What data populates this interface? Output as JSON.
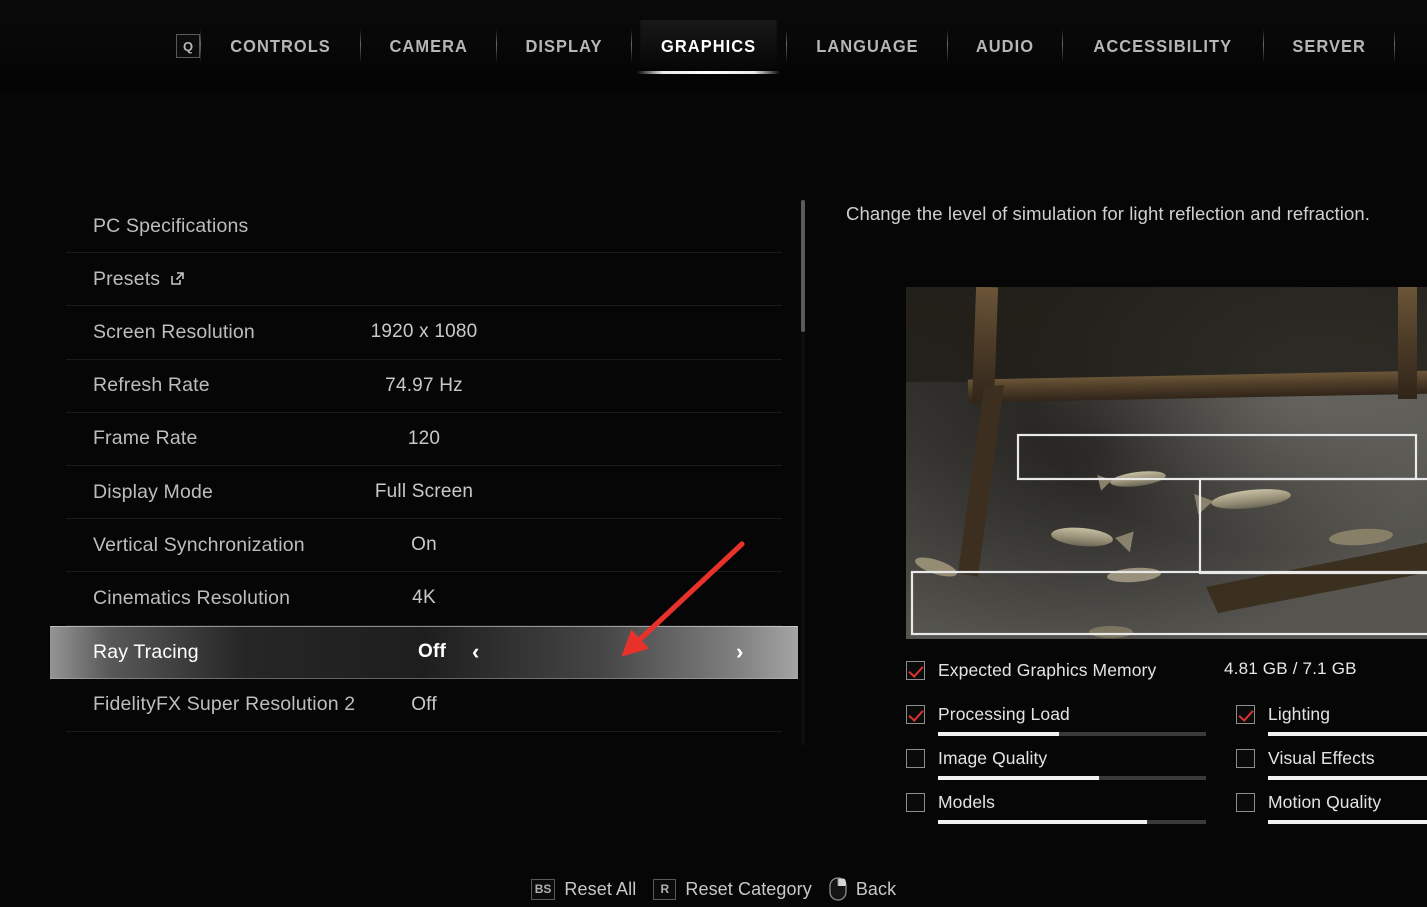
{
  "tabbar": {
    "key_badge": "Q",
    "tabs": [
      {
        "label": "CONTROLS",
        "active": false
      },
      {
        "label": "CAMERA",
        "active": false
      },
      {
        "label": "DISPLAY",
        "active": false
      },
      {
        "label": "GRAPHICS",
        "active": true
      },
      {
        "label": "LANGUAGE",
        "active": false
      },
      {
        "label": "AUDIO",
        "active": false
      },
      {
        "label": "ACCESSIBILITY",
        "active": false
      },
      {
        "label": "SERVER",
        "active": false
      }
    ]
  },
  "settings": {
    "rows": [
      {
        "label": "PC Specifications",
        "value": "",
        "selected": false,
        "icon": ""
      },
      {
        "label": "Presets",
        "value": "",
        "selected": false,
        "icon": "external-link-icon"
      },
      {
        "label": "Screen Resolution",
        "value": "1920 x 1080",
        "selected": false,
        "icon": ""
      },
      {
        "label": "Refresh Rate",
        "value": "74.97 Hz",
        "selected": false,
        "icon": ""
      },
      {
        "label": "Frame Rate",
        "value": "120",
        "selected": false,
        "icon": ""
      },
      {
        "label": "Display Mode",
        "value": "Full Screen",
        "selected": false,
        "icon": ""
      },
      {
        "label": "Vertical Synchronization",
        "value": "On",
        "selected": false,
        "icon": ""
      },
      {
        "label": "Cinematics Resolution",
        "value": "4K",
        "selected": false,
        "icon": ""
      },
      {
        "label": "Ray Tracing",
        "value": "Off",
        "selected": true,
        "icon": ""
      },
      {
        "label": "FidelityFX Super Resolution 2",
        "value": "Off",
        "selected": false,
        "icon": ""
      }
    ],
    "arrow_left": "‹",
    "arrow_right": "›"
  },
  "detail": {
    "description": "Change the level of simulation for light reflection and refraction."
  },
  "meters": {
    "left": [
      {
        "label": "Expected Graphics Memory",
        "checked": true,
        "value": "4.81 GB / 7.1 GB",
        "bar": null
      },
      {
        "label": "Processing Load",
        "checked": true,
        "value": "",
        "bar": 45
      },
      {
        "label": "Image Quality",
        "checked": false,
        "value": "",
        "bar": 60
      },
      {
        "label": "Models",
        "checked": false,
        "value": "",
        "bar": 78
      }
    ],
    "right": [
      {
        "label": "Lighting",
        "checked": true,
        "value": "",
        "bar": 100
      },
      {
        "label": "Visual Effects",
        "checked": false,
        "value": "",
        "bar": 100
      },
      {
        "label": "Motion Quality",
        "checked": false,
        "value": "",
        "bar": 100
      }
    ]
  },
  "footer": {
    "items": [
      {
        "key": "BS",
        "label": "Reset All",
        "icon": "key-badge"
      },
      {
        "key": "R",
        "label": "Reset Category",
        "icon": "key-badge"
      },
      {
        "key": "",
        "label": "Back",
        "icon": "mouse-right-click-icon"
      }
    ]
  },
  "colors": {
    "accent_check": "#d8352f",
    "annotation_arrow": "#e8312a",
    "text_primary": "#e3e3e3",
    "text_secondary": "#bdbdbd",
    "background": "#060606",
    "bar_fill": "#f2f2f2",
    "bar_track": "#3a3a3a"
  }
}
